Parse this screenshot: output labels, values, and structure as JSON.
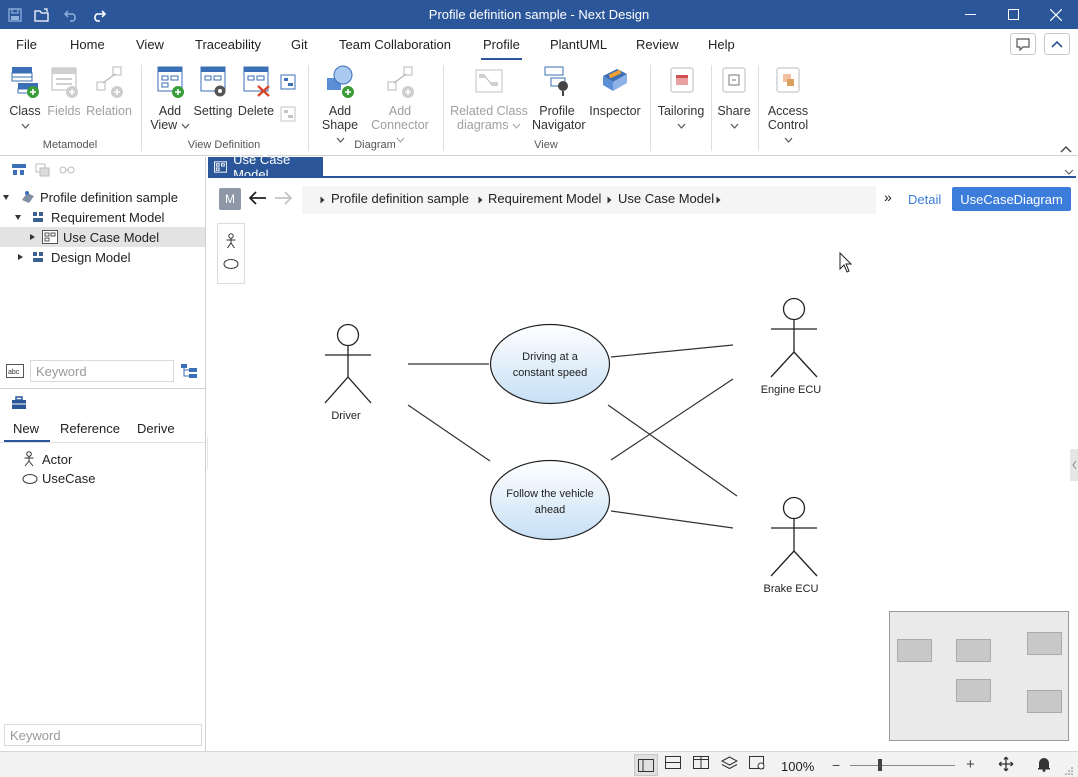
{
  "window": {
    "title": "Profile definition sample - Next Design"
  },
  "menu": {
    "tabs": [
      "File",
      "Home",
      "View",
      "Traceability",
      "Git",
      "Team Collaboration",
      "Profile",
      "PlantUML",
      "Review",
      "Help"
    ],
    "active": "Profile"
  },
  "ribbon": {
    "metamodel": {
      "group": "Metamodel",
      "class": "Class",
      "fields": "Fields",
      "relation": "Relation"
    },
    "view_definition": {
      "group": "View Definition",
      "add_view_1": "Add",
      "add_view_2": "View",
      "setting": "Setting",
      "delete": "Delete"
    },
    "diagram": {
      "group": "Diagram",
      "add_shape_1": "Add",
      "add_shape_2": "Shape",
      "add_connector_1": "Add",
      "add_connector_2": "Connector"
    },
    "view": {
      "group": "View",
      "related_1": "Related Class",
      "related_2": "diagrams",
      "navigator_1": "Profile",
      "navigator_2": "Navigator",
      "inspector": "Inspector"
    },
    "tailoring": "Tailoring",
    "share": "Share",
    "access_1": "Access",
    "access_2": "Control"
  },
  "tree": {
    "root": "Profile definition sample",
    "requirement": "Requirement Model",
    "usecase": "Use Case Model",
    "design": "Design Model"
  },
  "search": {
    "top_placeholder": "Keyword",
    "bottom_placeholder": "Keyword"
  },
  "toolbox": {
    "tabs": [
      "New",
      "Reference",
      "Derive"
    ],
    "active_tab": "New",
    "items": [
      "Actor",
      "UseCase"
    ]
  },
  "editor": {
    "tab_title": "Use Case Model",
    "model_badge": "M",
    "breadcrumb": [
      "Profile definition sample",
      "Requirement Model",
      "Use Case Model"
    ],
    "detail_link": "Detail",
    "view_button": "UseCaseDiagram"
  },
  "diagram": {
    "actors": [
      "Driver",
      "Engine ECU",
      "Brake ECU"
    ],
    "usecases": [
      "Driving at a constant speed",
      "Follow the vehicle ahead"
    ],
    "usecase_lines": [
      [
        "Driving at a",
        "constant speed"
      ],
      [
        "Follow the vehicle",
        "ahead"
      ]
    ]
  },
  "status": {
    "zoom": "100%"
  },
  "colors": {
    "accent": "#2b579a",
    "button": "#3c7ddb",
    "usecase_fill_top": "#ffffff",
    "usecase_fill_bottom": "#c8e0f6"
  }
}
